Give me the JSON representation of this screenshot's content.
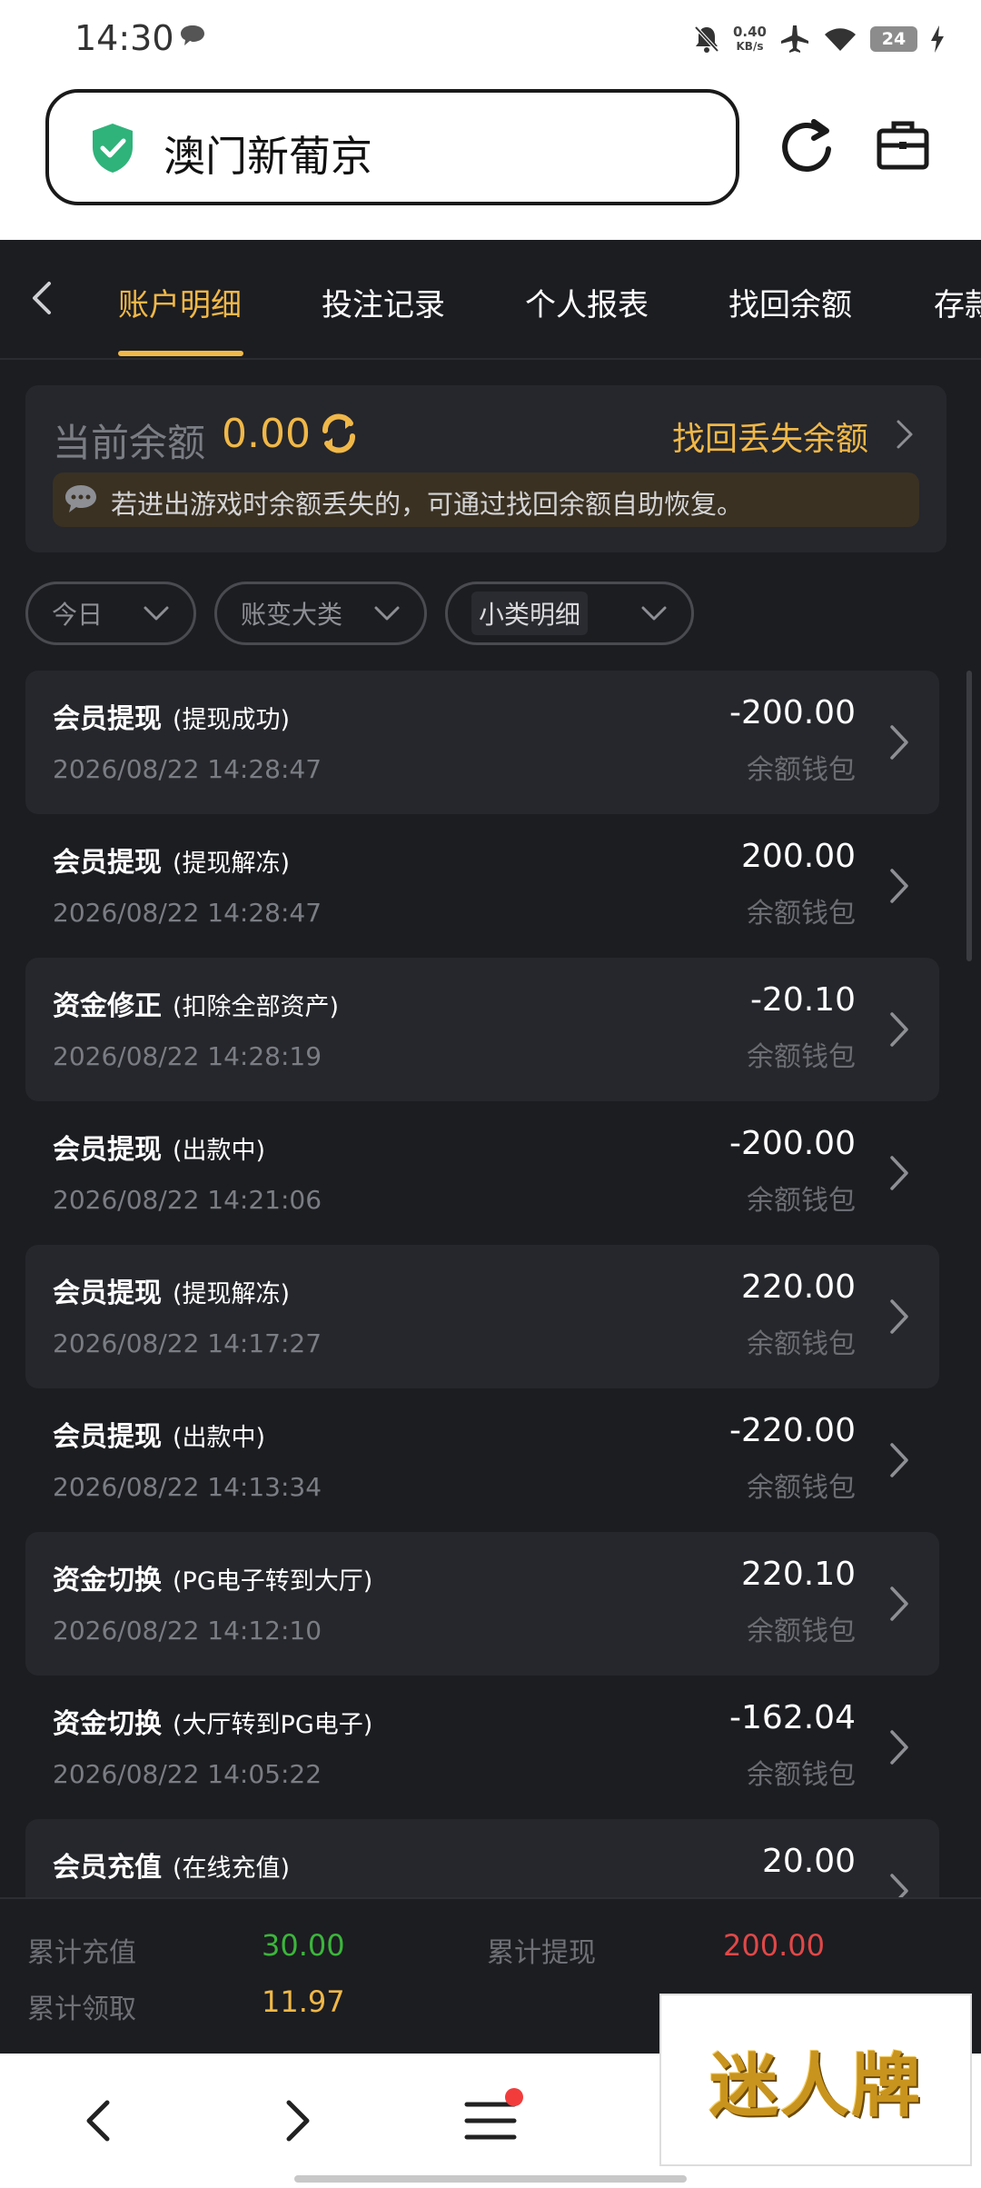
{
  "status_bar": {
    "time": "14:30",
    "net_speed_value": "0.40",
    "net_speed_unit": "KB/s",
    "battery": "24"
  },
  "browser": {
    "url_title": "澳门新葡京",
    "icons": [
      "shield-check-icon",
      "reload-icon",
      "briefcase-icon"
    ]
  },
  "tabs": [
    {
      "label": "账户明细",
      "active": true
    },
    {
      "label": "投注记录",
      "active": false
    },
    {
      "label": "个人报表",
      "active": false
    },
    {
      "label": "找回余额",
      "active": false
    },
    {
      "label": "存款",
      "active": false
    }
  ],
  "balance": {
    "label": "当前余额",
    "value": "0.00",
    "recover_link": "找回丢失余额",
    "tip": "若进出游戏时余额丢失的，可通过找回余额自助恢复。"
  },
  "filters": [
    {
      "label": "今日"
    },
    {
      "label": "账变大类"
    },
    {
      "label": "小类明细"
    }
  ],
  "records": [
    {
      "title": "会员提现",
      "sub": "(提现成功)",
      "time": "2026/08/22 14:28:47",
      "amount": "-200.00",
      "wallet": "余额钱包"
    },
    {
      "title": "会员提现",
      "sub": "(提现解冻)",
      "time": "2026/08/22 14:28:47",
      "amount": "200.00",
      "wallet": "余额钱包"
    },
    {
      "title": "资金修正",
      "sub": "(扣除全部资产)",
      "time": "2026/08/22 14:28:19",
      "amount": "-20.10",
      "wallet": "余额钱包"
    },
    {
      "title": "会员提现",
      "sub": "(出款中)",
      "time": "2026/08/22 14:21:06",
      "amount": "-200.00",
      "wallet": "余额钱包"
    },
    {
      "title": "会员提现",
      "sub": "(提现解冻)",
      "time": "2026/08/22 14:17:27",
      "amount": "220.00",
      "wallet": "余额钱包"
    },
    {
      "title": "会员提现",
      "sub": "(出款中)",
      "time": "2026/08/22 14:13:34",
      "amount": "-220.00",
      "wallet": "余额钱包"
    },
    {
      "title": "资金切换",
      "sub": "(PG电子转到大厅)",
      "time": "2026/08/22 14:12:10",
      "amount": "220.10",
      "wallet": "余额钱包"
    },
    {
      "title": "资金切换",
      "sub": "(大厅转到PG电子)",
      "time": "2026/08/22 14:05:22",
      "amount": "-162.04",
      "wallet": "余额钱包"
    },
    {
      "title": "会员充值",
      "sub": "(在线充值)",
      "time": "",
      "amount": "20.00",
      "wallet": ""
    }
  ],
  "summary": {
    "recharge_label": "累计充值",
    "recharge_value": "30.00",
    "withdraw_label": "累计提现",
    "withdraw_value": "200.00",
    "claim_label": "累计领取",
    "claim_value": "11.97",
    "colors": {
      "recharge": "#3cb53c",
      "withdraw": "#e04848",
      "claim": "#f0b848"
    }
  },
  "watermark": "迷人牌",
  "accent_color": "#f0b848"
}
